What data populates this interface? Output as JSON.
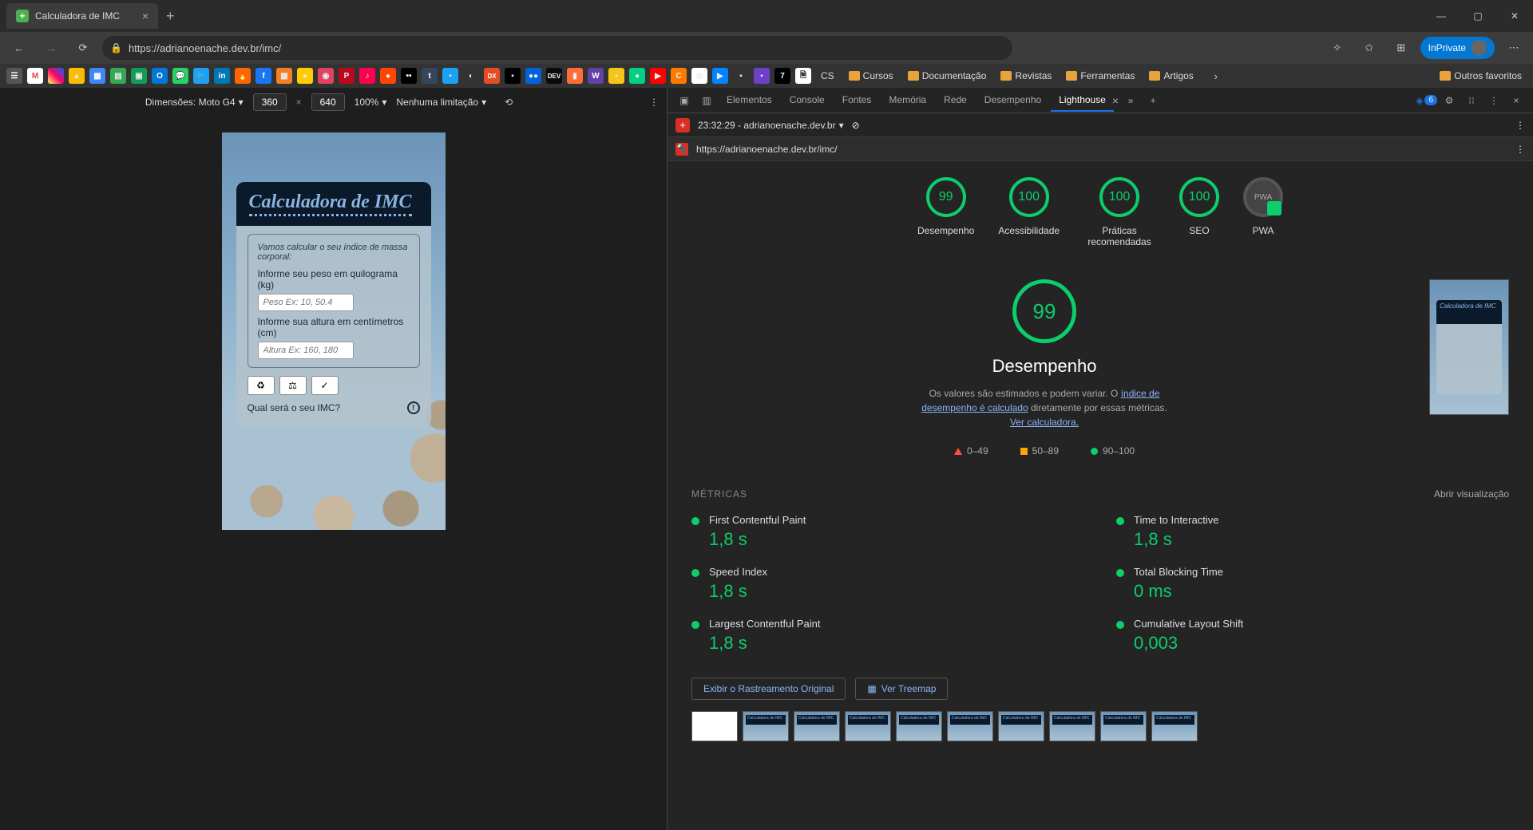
{
  "window": {
    "tab_title": "Calculadora de IMC"
  },
  "toolbar": {
    "url": "https://adrianoenache.dev.br/imc/",
    "inprivate": "InPrivate"
  },
  "bookmarks": {
    "folders": [
      "CS",
      "Cursos",
      "Documentação",
      "Revistas",
      "Ferramentas",
      "Artigos"
    ],
    "overflow": "Outros favoritos"
  },
  "devicebar": {
    "label": "Dimensões: Moto G4",
    "width": "360",
    "height": "640",
    "zoom": "100%",
    "throttle": "Nenhuma limitação"
  },
  "app": {
    "title": "Calculadora de IMC",
    "legend": "Vamos calcular o seu índice de massa corporal:",
    "weight_label": "Informe seu peso em quilograma (kg)",
    "weight_ph": "Peso Ex: 10, 50.4",
    "height_label": "Informe sua altura em centímetros (cm)",
    "height_ph": "Altura Ex: 160, 180",
    "question": "Qual será o seu IMC?"
  },
  "devtools": {
    "tabs": [
      "Elementos",
      "Console",
      "Fontes",
      "Memória",
      "Rede",
      "Desempenho",
      "Lighthouse"
    ],
    "active": "Lighthouse",
    "issue_count": "6"
  },
  "lighthouse": {
    "run": "23:32:29 - adrianoenache.dev.br",
    "audit_url": "https://adrianoenache.dev.br/imc/",
    "gauges": [
      {
        "score": "99",
        "label": "Desempenho"
      },
      {
        "score": "100",
        "label": "Acessibilidade"
      },
      {
        "score": "100",
        "label": "Práticas recomendadas"
      },
      {
        "score": "100",
        "label": "SEO"
      },
      {
        "score": "PWA",
        "label": "PWA"
      }
    ],
    "perf": {
      "score": "99",
      "title": "Desempenho",
      "desc_prefix": "Os valores são estimados e podem variar. O ",
      "desc_link1": "índice de desempenho é calculado",
      "desc_mid": " diretamente por essas métricas. ",
      "desc_link2": "Ver calculadora.",
      "legend": [
        "0–49",
        "50–89",
        "90–100"
      ]
    },
    "metrics_head": "MÉTRICAS",
    "expand": "Abrir visualização",
    "metrics": [
      {
        "label": "First Contentful Paint",
        "value": "1,8 s"
      },
      {
        "label": "Time to Interactive",
        "value": "1,8 s"
      },
      {
        "label": "Speed Index",
        "value": "1,8 s"
      },
      {
        "label": "Total Blocking Time",
        "value": "0 ms"
      },
      {
        "label": "Largest Contentful Paint",
        "value": "1,8 s"
      },
      {
        "label": "Cumulative Layout Shift",
        "value": "0,003"
      }
    ],
    "trace_btn": "Exibir o Rastreamento Original",
    "treemap_btn": "Ver Treemap",
    "thumb_title": "Calculadora de IMC"
  }
}
